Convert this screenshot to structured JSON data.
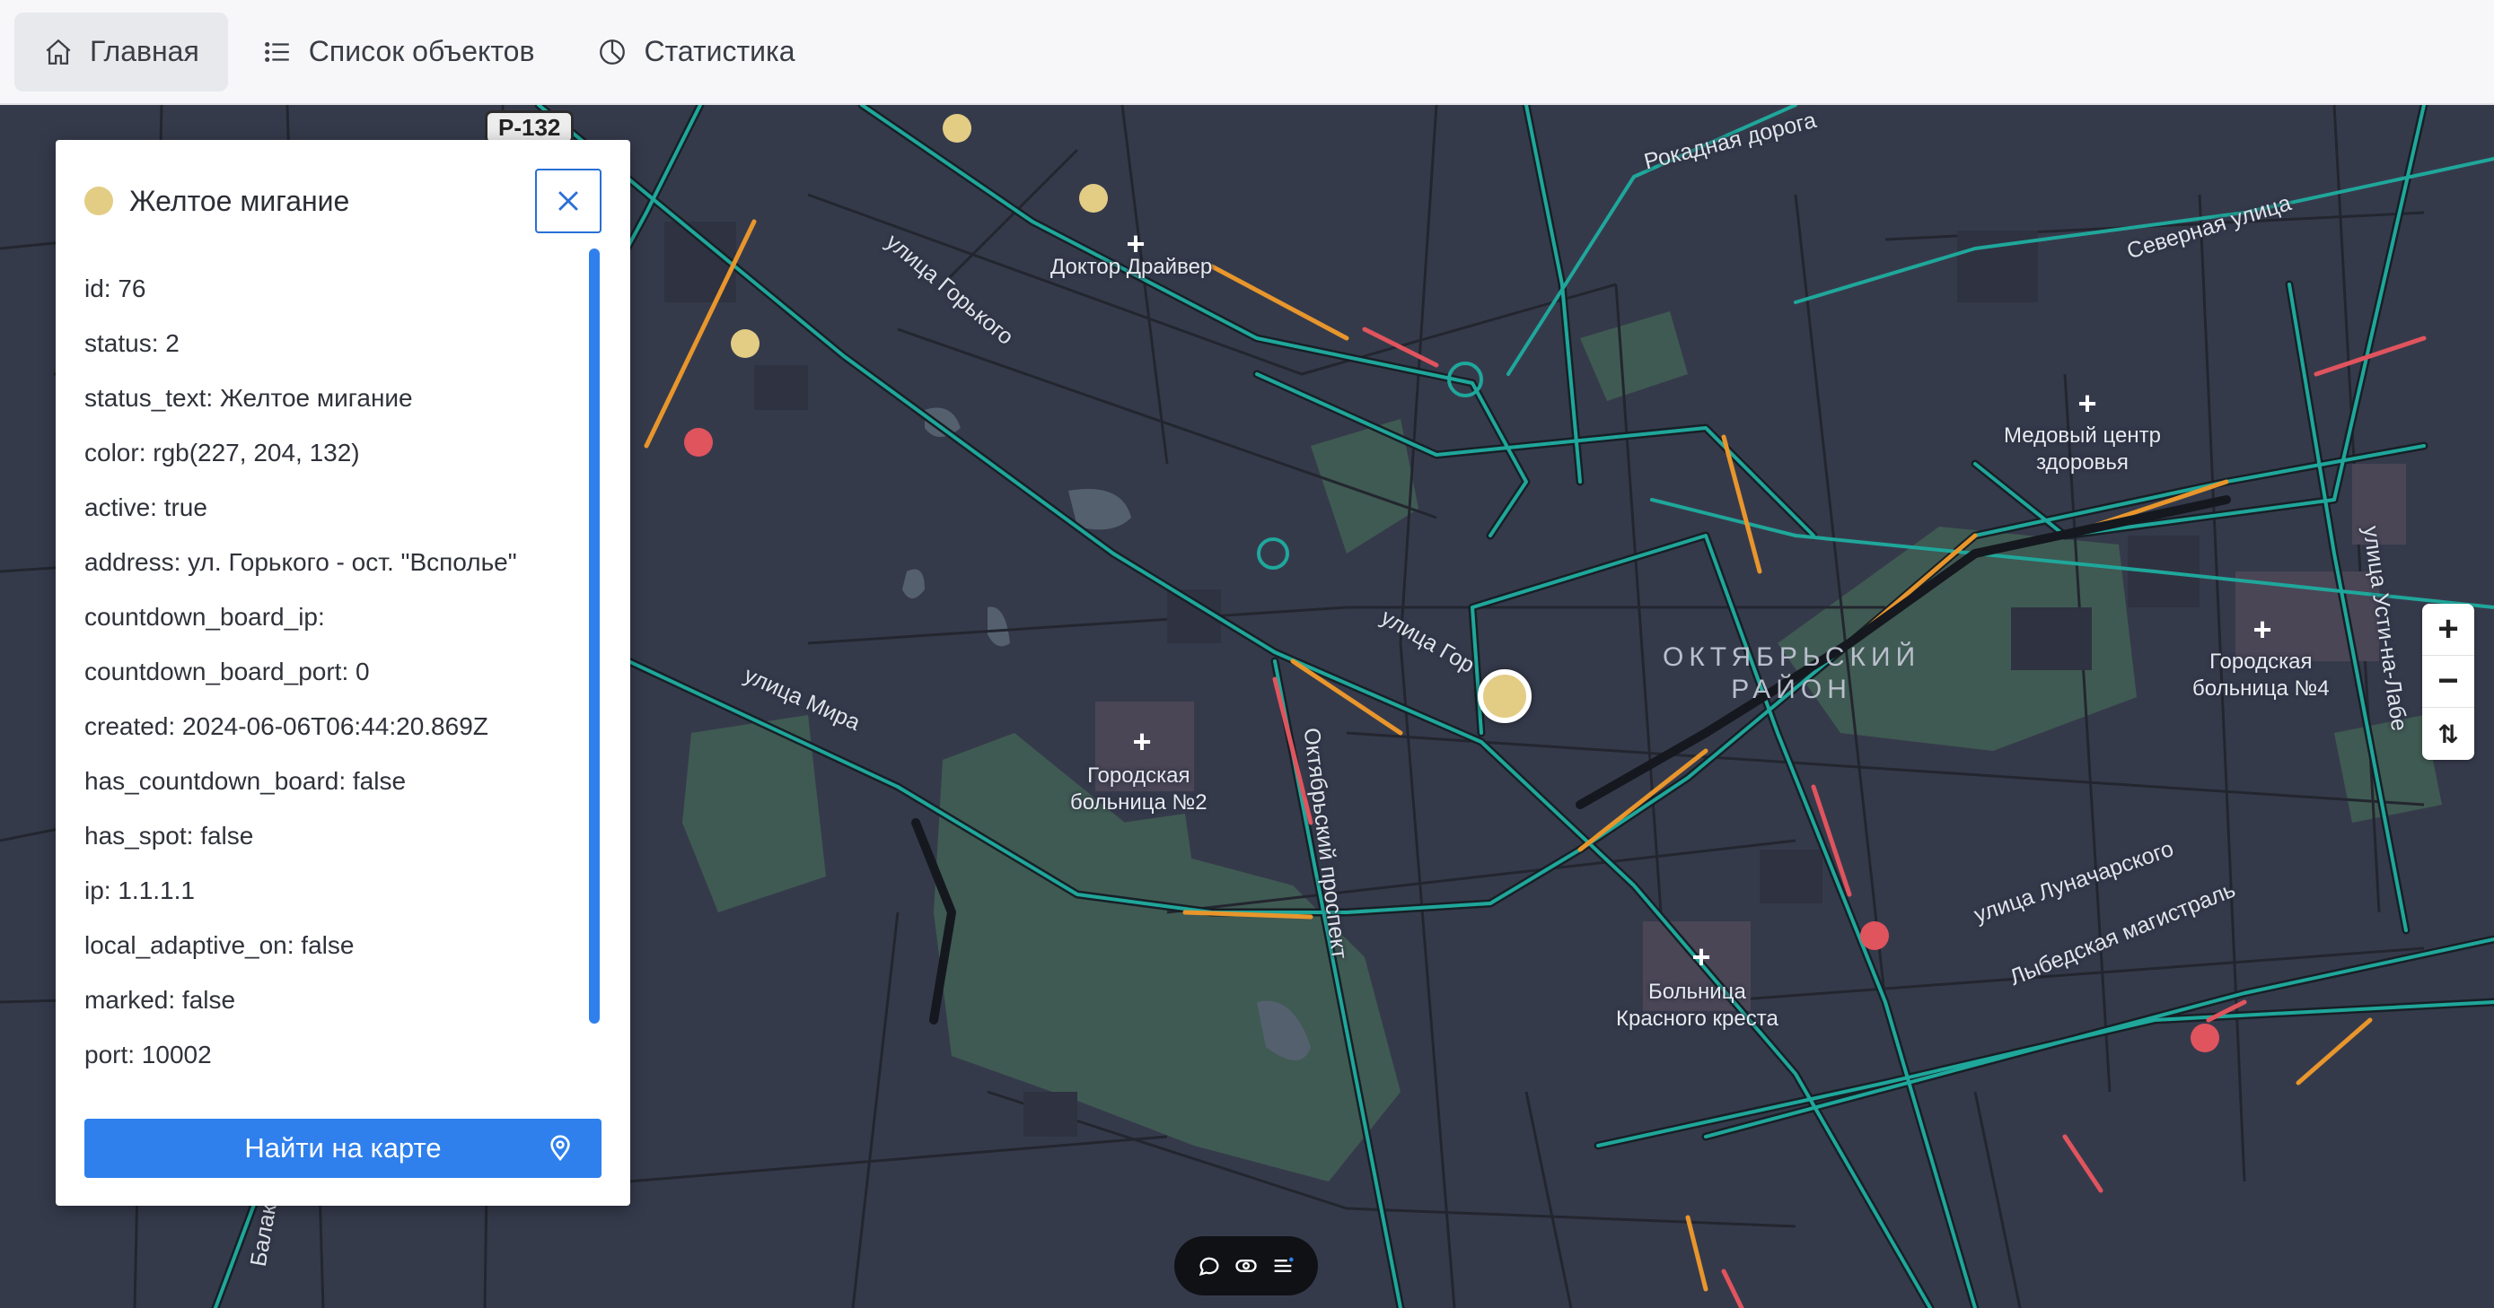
{
  "nav": {
    "tabs": [
      {
        "label": "Главная",
        "icon": "home-icon",
        "active": true
      },
      {
        "label": "Список объектов",
        "icon": "list-icon",
        "active": false
      },
      {
        "label": "Статистика",
        "icon": "pie-chart-icon",
        "active": false
      }
    ]
  },
  "map": {
    "road_badge": "Р-132",
    "district": "ОКТЯБРЬСКИЙ\nРАЙОН",
    "places": [
      {
        "name": "Доктор Драйвер"
      },
      {
        "name": "Медовый центр\nздоровья"
      },
      {
        "name": "Городская\nбольница №2"
      },
      {
        "name": "Городская\nбольница №4"
      },
      {
        "name": "Больница\nКрасного креста"
      }
    ],
    "streets": {
      "gorkogo": "улица Горького",
      "gorkogo2": "улица Гор",
      "mira": "улица Мира",
      "rokadnaya": "Рокадная дорога",
      "severnaya": "Северная улица",
      "oktyabrsky": "Октябрьский проспект",
      "lunacharskogo": "улица Луначарского",
      "lybedskaya": "Лыбедская магистраль",
      "usti": "улица Усти-на-Лабе",
      "balakireva": "Балакирев"
    },
    "signal_colors": {
      "yellow": "#e3cc84",
      "red": "#e0545e"
    },
    "zoom": {
      "in": "+",
      "out": "−",
      "compass": "⇅"
    }
  },
  "panel": {
    "title": "Желтое мигание",
    "status_color": "#e3cc84",
    "properties": [
      "id: 76",
      "status: 2",
      "status_text: Желтое мигание",
      "color: rgb(227, 204, 132)",
      "active: true",
      "address: ул. Горького - ост. \"Всполье\"",
      "countdown_board_ip:",
      "countdown_board_port: 0",
      "created: 2024-06-06T06:44:20.869Z",
      "has_countdown_board: false",
      "has_spot: false",
      "ip: 1.1.1.1",
      "local_adaptive_on: false",
      "marked: false",
      "port: 10002"
    ],
    "find_button": "Найти на карте"
  },
  "colors": {
    "accent": "#2f80ed",
    "map_bg": "#353a4b",
    "road_teal": "#1fa79b",
    "road_orange": "#e8962c",
    "road_red": "#e0545e"
  }
}
